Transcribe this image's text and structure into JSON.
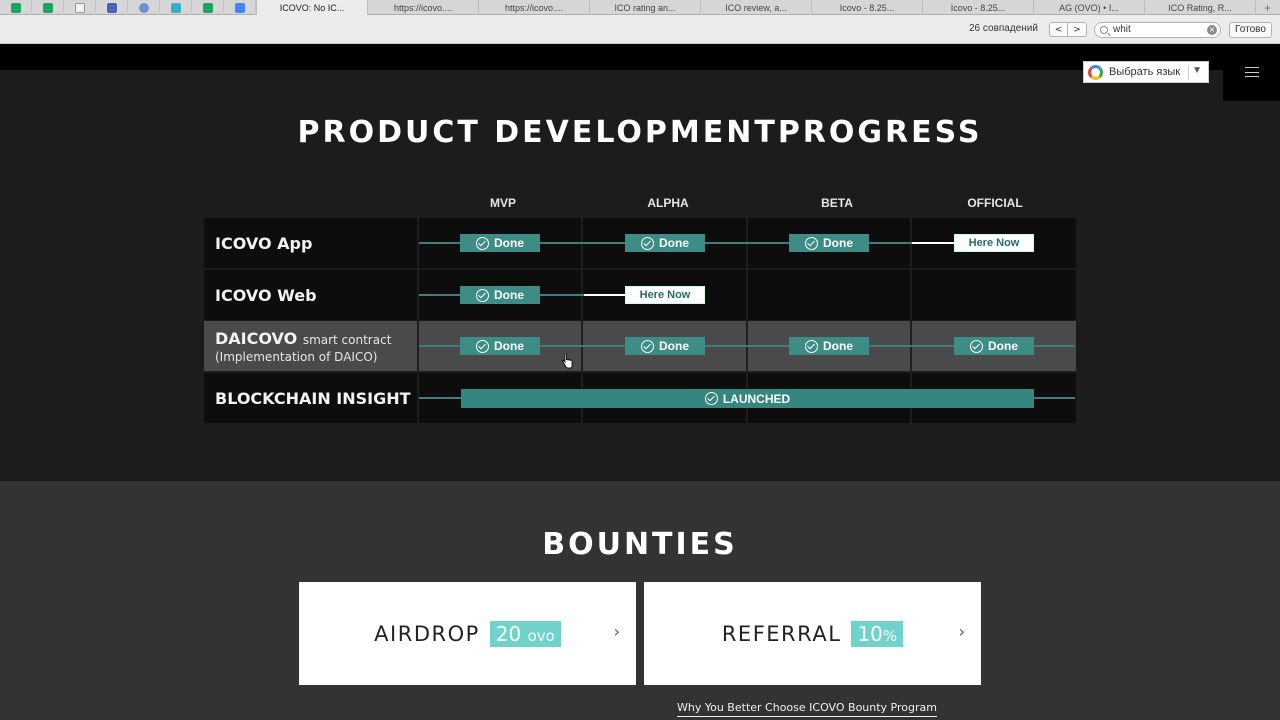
{
  "browser": {
    "tabs": [
      "ICOVO: No IC...",
      "https://icovo....",
      "https://icovo....",
      "ICO rating an...",
      "ICO review, a...",
      "Icovo - 8.25...",
      "Icovo - 8.25...",
      "AG (OVO) • I...",
      "ICO Rating, R..."
    ],
    "new_tab": "+",
    "find": {
      "matches": "26 совпадений",
      "prev": "<",
      "next": ">",
      "query": "whit",
      "clear": "×",
      "done": "Готово"
    }
  },
  "header": {
    "language_button": "Выбрать язык",
    "language_arrow": "▼"
  },
  "dev_progress": {
    "title": "PRODUCT DEVELOPMENTPROGRESS",
    "columns": [
      "MVP",
      "ALPHA",
      "BETA",
      "OFFICIAL"
    ],
    "rows": [
      {
        "name": "ICOVO App",
        "small": "",
        "sub": ""
      },
      {
        "name": "ICOVO Web",
        "small": "",
        "sub": ""
      },
      {
        "name": "DAICOVO",
        "small": "smart contract",
        "sub": "(Implementation of DAICO)"
      },
      {
        "name": "BLOCKCHAIN INSIGHT",
        "small": "",
        "sub": ""
      }
    ],
    "done_label": "Done",
    "here_now_label": "Here Now",
    "launched_label": "LAUNCHED"
  },
  "bounties": {
    "title": "BOUNTIES",
    "airdrop": {
      "label": "AIRDROP",
      "value": "20",
      "unit": "ovo"
    },
    "referral": {
      "label": "REFERRAL",
      "value": "10",
      "unit": "%"
    },
    "arrow": "›",
    "link": "Why You Better Choose ICOVO Bounty Program"
  },
  "colors": {
    "accent": "#3d8c86",
    "pill": "#6fd3cb"
  }
}
